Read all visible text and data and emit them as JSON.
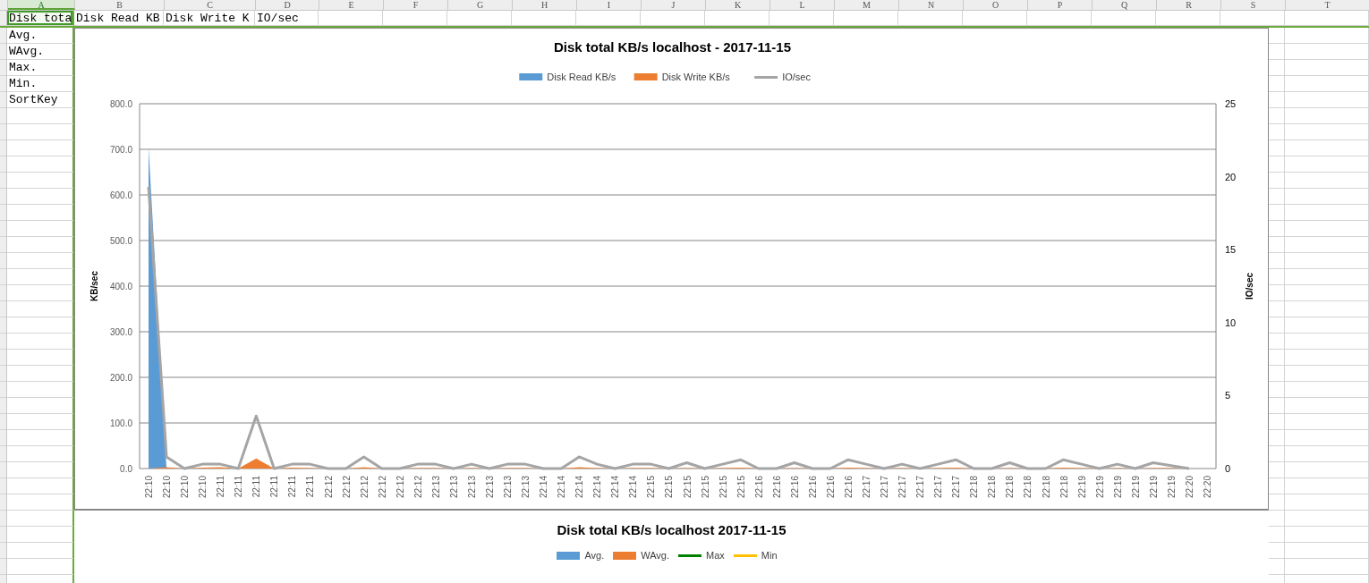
{
  "sheet": {
    "columns": [
      {
        "label": "A",
        "selected": true
      },
      {
        "label": "B",
        "selected": false
      },
      {
        "label": "C",
        "selected": false
      },
      {
        "label": "D",
        "selected": false
      },
      {
        "label": "E",
        "selected": false
      },
      {
        "label": "F",
        "selected": false
      },
      {
        "label": "G",
        "selected": false
      },
      {
        "label": "H",
        "selected": false
      },
      {
        "label": "I",
        "selected": false
      },
      {
        "label": "J",
        "selected": false
      },
      {
        "label": "K",
        "selected": false
      },
      {
        "label": "L",
        "selected": false
      },
      {
        "label": "M",
        "selected": false
      },
      {
        "label": "N",
        "selected": false
      },
      {
        "label": "O",
        "selected": false
      },
      {
        "label": "P",
        "selected": false
      },
      {
        "label": "Q",
        "selected": false
      },
      {
        "label": "R",
        "selected": false
      },
      {
        "label": "S",
        "selected": false
      },
      {
        "label": "T",
        "selected": false
      }
    ],
    "rows": [
      [
        {
          "text": "Disk tota",
          "selected": true
        },
        {
          "text": "Disk Read KB",
          "selected": false
        },
        {
          "text": "Disk Write K",
          "selected": false
        },
        {
          "text": "IO/sec",
          "selected": false
        }
      ],
      [
        {
          "text": "Avg.",
          "selected": false
        }
      ],
      [
        {
          "text": "WAvg.",
          "selected": false
        }
      ],
      [
        {
          "text": "Max.",
          "selected": false
        }
      ],
      [
        {
          "text": "Min.",
          "selected": false
        }
      ],
      [
        {
          "text": "SortKey",
          "selected": false
        }
      ]
    ]
  },
  "chart": {
    "chart_data": {
      "type": "area",
      "grid": true,
      "legend": "top",
      "title": "Disk total KB/s localhost - 2017-11-15",
      "ylabel": "KB/sec",
      "y2label": "IO/sec",
      "ylim": [
        0,
        800
      ],
      "y2lim": [
        0,
        25
      ],
      "yticks": [
        {
          "value": 0,
          "label": "0.0"
        },
        {
          "value": 100,
          "label": "100.0"
        },
        {
          "value": 200,
          "label": "200.0"
        },
        {
          "value": 300,
          "label": "300.0"
        },
        {
          "value": 400,
          "label": "400.0"
        },
        {
          "value": 500,
          "label": "500.0"
        },
        {
          "value": 600,
          "label": "600.0"
        },
        {
          "value": 700,
          "label": "700.0"
        },
        {
          "value": 800,
          "label": "800.0"
        }
      ],
      "y2ticks": [
        0,
        5,
        10,
        15,
        20,
        25
      ],
      "categories": [
        "22:10",
        "22:10",
        "22:10",
        "22:10",
        "22:11",
        "22:11",
        "22:11",
        "22:11",
        "22:11",
        "22:11",
        "22:12",
        "22:12",
        "22:12",
        "22:12",
        "22:12",
        "22:12",
        "22:13",
        "22:13",
        "22:13",
        "22:13",
        "22:13",
        "22:13",
        "22:14",
        "22:14",
        "22:14",
        "22:14",
        "22:14",
        "22:14",
        "22:15",
        "22:15",
        "22:15",
        "22:15",
        "22:15",
        "22:15",
        "22:16",
        "22:16",
        "22:16",
        "22:16",
        "22:16",
        "22:16",
        "22:17",
        "22:17",
        "22:17",
        "22:17",
        "22:17",
        "22:17",
        "22:18",
        "22:18",
        "22:18",
        "22:18",
        "22:18",
        "22:18",
        "22:19",
        "22:19",
        "22:19",
        "22:19",
        "22:19",
        "22:19",
        "22:20",
        "22:20"
      ],
      "series": [
        {
          "name": "Disk Read KB/s",
          "color": "#5b9bd5",
          "values": [
            705,
            0,
            0,
            0,
            0,
            0,
            0,
            0,
            0,
            0,
            0,
            0,
            0,
            0,
            0,
            0,
            0,
            0,
            0,
            0,
            0,
            0,
            0,
            0,
            0,
            0,
            0,
            0,
            0,
            0,
            0,
            0,
            0,
            0,
            0,
            0,
            0,
            0,
            0,
            0,
            0,
            0,
            0,
            0,
            0,
            0,
            0,
            0,
            0,
            0,
            0,
            0,
            0,
            0,
            0,
            0,
            0,
            0,
            0,
            0
          ]
        },
        {
          "name": "Disk Write KB/s",
          "color": "#ed7d31",
          "values": [
            0,
            3,
            0,
            2,
            3,
            0,
            22,
            0,
            2,
            1,
            0,
            0,
            3,
            0,
            0,
            1,
            1,
            0,
            1,
            0,
            1,
            1,
            0,
            0,
            3,
            1,
            0,
            1,
            1,
            0,
            1,
            0,
            1,
            2,
            0,
            0,
            1,
            0,
            0,
            2,
            1,
            0,
            1,
            0,
            1,
            2,
            0,
            0,
            1,
            0,
            0,
            2,
            1,
            0,
            1,
            0,
            1,
            1,
            0,
            0
          ]
        },
        {
          "name": "IO/sec",
          "color": "#a5a5a5",
          "type": "line",
          "axis": "y2",
          "values": [
            19.3,
            0.8,
            0,
            0.3,
            0.3,
            0,
            3.6,
            0,
            0.3,
            0.3,
            0,
            0,
            0.8,
            0,
            0,
            0.3,
            0.3,
            0,
            0.3,
            0,
            0.3,
            0.3,
            0,
            0,
            0.8,
            0.3,
            0,
            0.3,
            0.3,
            0,
            0.4,
            0,
            0.3,
            0.6,
            0,
            0,
            0.4,
            0,
            0,
            0.6,
            0.3,
            0,
            0.3,
            0,
            0.3,
            0.6,
            0,
            0,
            0.4,
            0,
            0,
            0.6,
            0.3,
            0,
            0.3,
            0,
            0.4,
            0.2,
            0,
            null
          ]
        }
      ]
    }
  },
  "chart_2": {
    "title": "Disk total KB/s localhost  2017-11-15",
    "legend": [
      {
        "label": "Avg.",
        "color": "#5b9bd5",
        "kind": "swatch"
      },
      {
        "label": "WAvg.",
        "color": "#ed7d31",
        "kind": "swatch"
      },
      {
        "label": "Max",
        "color": "#008000",
        "kind": "line"
      },
      {
        "label": "Min",
        "color": "#ffc000",
        "kind": "line"
      }
    ]
  }
}
